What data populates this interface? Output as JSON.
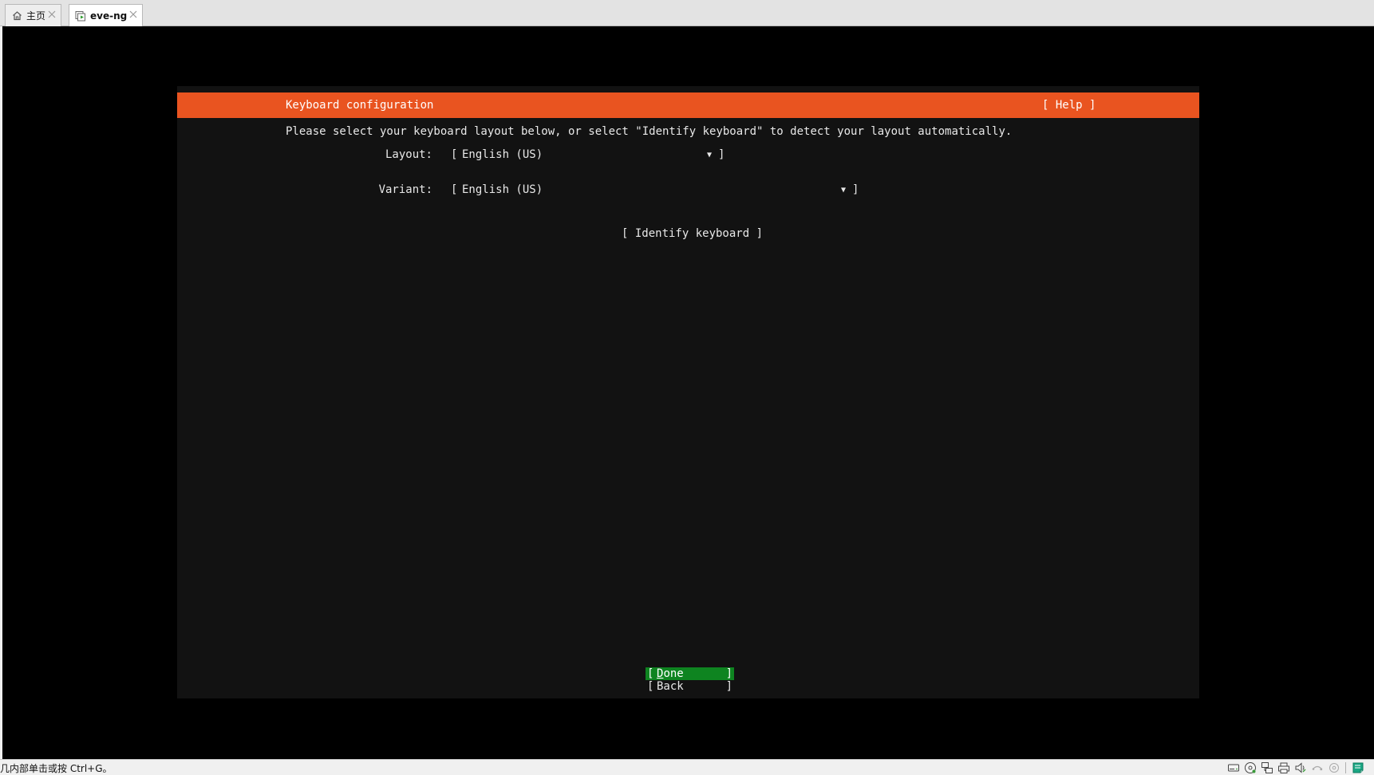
{
  "tabs": [
    {
      "label": "主页",
      "icon": "home-icon",
      "active": false
    },
    {
      "label": "eve-ng",
      "icon": "vm-icon",
      "active": true
    }
  ],
  "installer": {
    "title": "Keyboard configuration",
    "help_label": "[ Help ]",
    "instructions": "Please select your keyboard layout below, or select \"Identify keyboard\" to detect your layout automatically.",
    "layout": {
      "label": "Layout:",
      "value": "English (US)"
    },
    "variant": {
      "label": "Variant:",
      "value": "English (US)"
    },
    "identify_label": "[ Identify keyboard ]",
    "done_label": "Done",
    "back_label": "Back",
    "header_color": "#e95420",
    "done_color": "#0e8420"
  },
  "statusbar": {
    "message": "几内部单击或按 Ctrl+G。",
    "device_icons": [
      "hard-disk-icon",
      "cd-rom-icon",
      "network-adapter-icon",
      "printer-icon",
      "sound-card-icon",
      "usb-icon",
      "floppy-icon",
      "message-log-icon"
    ]
  }
}
